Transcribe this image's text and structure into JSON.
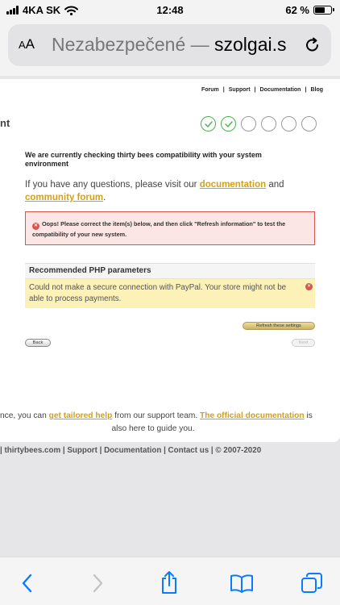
{
  "status_bar": {
    "carrier": "4KA SK",
    "time": "12:48",
    "battery_percent": "62 %",
    "battery_level": 0.62
  },
  "address_bar": {
    "text_size_button": "AA",
    "insecure_label": "Nezabezpečené —",
    "domain": "szolgai.s"
  },
  "page": {
    "top_nav": [
      "Forum",
      "Support",
      "Documentation",
      "Blog"
    ],
    "title_fragment": "nt",
    "steps_done": 2,
    "steps_total": 6,
    "heading": "We are currently checking thirty bees compatibility with your system environment",
    "info": {
      "before": "If you have any questions, please visit our ",
      "doc_link": "documentation",
      "between": " and ",
      "forum_link": "community forum",
      "after": "."
    },
    "error_message": "Oops! Please correct the item(s) below, and then click \"Refresh information\" to test the compatibility of your new system.",
    "php_params": {
      "title": "Recommended PHP parameters",
      "warning": "Could not make a secure connection with PayPal. Your store might not be able to process payments."
    },
    "refresh_button": "Refresh these settings",
    "back_button": "Back",
    "next_button": "Next",
    "support": {
      "part1": "nce, you can ",
      "help_link": "get tailored help",
      "part2": " from our support team. ",
      "docs_link": "The official documentation",
      "part3": " is",
      "line2": "also here to guide you."
    }
  },
  "footer": "| thirtybees.com | Support | Documentation | Contact us | © 2007-2020",
  "colors": {
    "accent_link": "#d4a017",
    "error_red": "#d9534f",
    "step_done_green": "#4caf50",
    "ios_blue": "#0a7aff"
  }
}
